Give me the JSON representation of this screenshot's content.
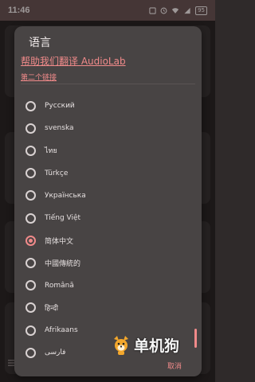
{
  "status_bar": {
    "time": "11:46",
    "icons": [
      "notification-icon",
      "alarm-icon",
      "wifi-icon",
      "signal-icon",
      "battery-icon"
    ],
    "battery": "95"
  },
  "dialog": {
    "title": "语言",
    "help_link": "帮助我们翻译 AudioLab",
    "second_link": "第二个链接",
    "accent_color": "#f08a8a",
    "cancel_label": "取消",
    "selected_index": 6,
    "languages": [
      "Русский",
      "svenska",
      "ไทย",
      "Türkçe",
      "Українська",
      "Tiếng Việt",
      "简体中文",
      "中國傳統的",
      "Română",
      "हिन्दी",
      "Afrikaans",
      "فارسی"
    ]
  },
  "background": {
    "bottom_icon": "menu-icon"
  },
  "watermark": {
    "text": "单机狗"
  }
}
